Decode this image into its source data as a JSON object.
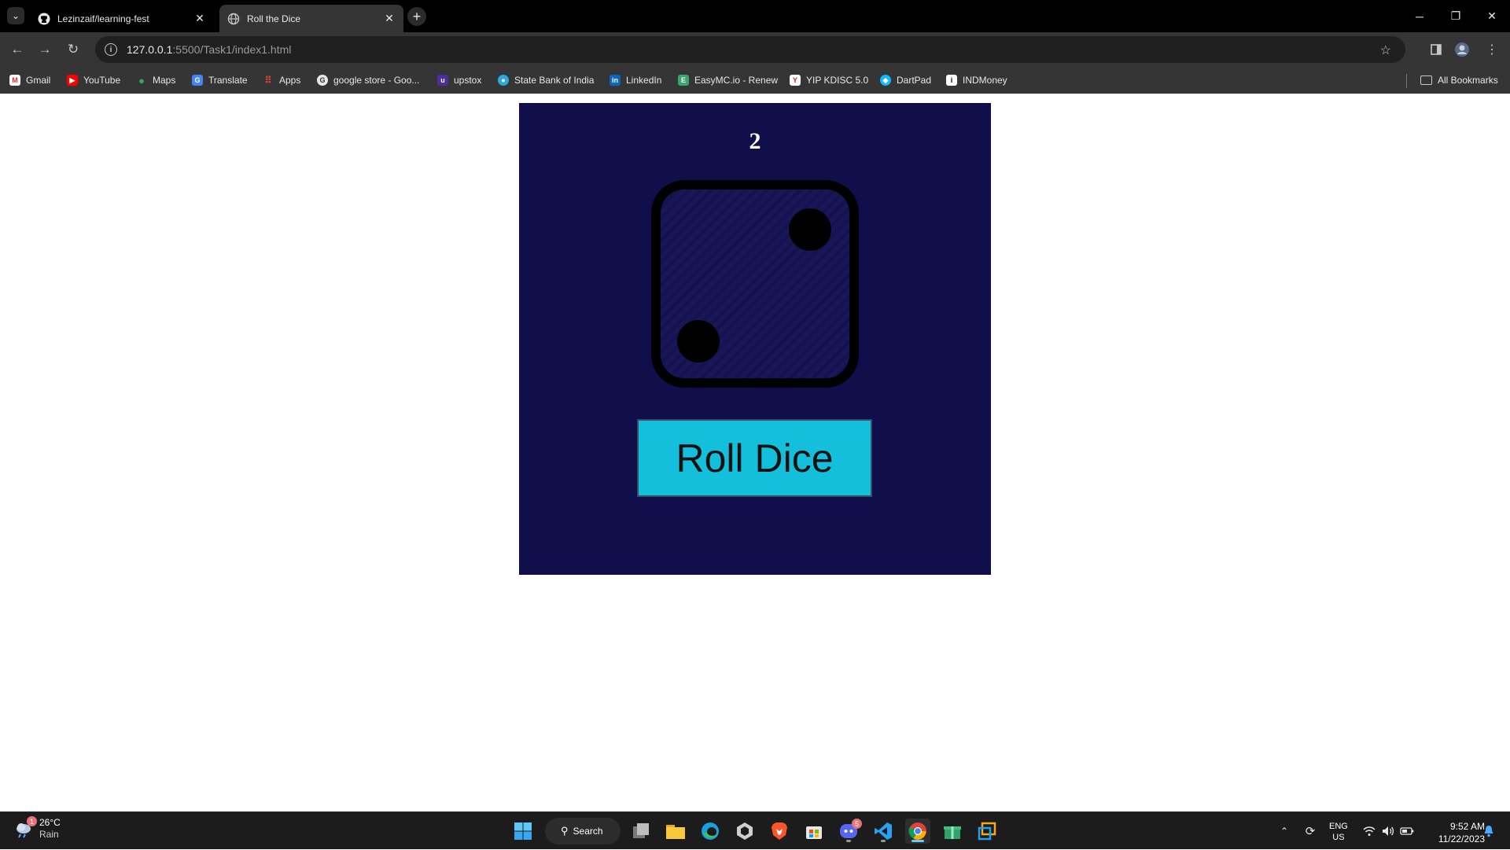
{
  "browser": {
    "tabs": [
      {
        "title": "Lezinzaif/learning-fest",
        "icon": "github-icon",
        "active": false
      },
      {
        "title": "Roll the Dice",
        "icon": "globe-icon",
        "active": true
      }
    ],
    "address": {
      "host": "127.0.0.1",
      "path": ":5500/Task1/index1.html"
    },
    "bookmarks": [
      {
        "label": "Gmail",
        "icon": "gmail-icon"
      },
      {
        "label": "YouTube",
        "icon": "youtube-icon"
      },
      {
        "label": "Maps",
        "icon": "maps-icon"
      },
      {
        "label": "Translate",
        "icon": "translate-icon"
      },
      {
        "label": "Apps",
        "icon": "apps-grid-icon"
      },
      {
        "label": "google store - Goo...",
        "icon": "google-store-icon"
      },
      {
        "label": "upstox",
        "icon": "upstox-icon"
      },
      {
        "label": "State Bank of India",
        "icon": "sbi-icon"
      },
      {
        "label": "LinkedIn",
        "icon": "linkedin-icon"
      },
      {
        "label": "EasyMC.io - Renew",
        "icon": "easymc-icon"
      },
      {
        "label": "YIP KDISC 5.0",
        "icon": "yip-icon"
      },
      {
        "label": "DartPad",
        "icon": "dartpad-icon"
      },
      {
        "label": "INDMoney",
        "icon": "indmoney-icon"
      }
    ],
    "all_bookmarks_label": "All Bookmarks"
  },
  "app": {
    "score": "2",
    "dice_face": 2,
    "roll_button_label": "Roll Dice",
    "colors": {
      "background": "#110f4b",
      "button": "#14bfdb",
      "dice_outline": "#000000"
    }
  },
  "taskbar": {
    "weather": {
      "temp": "26°C",
      "condition": "Rain",
      "badge": "1"
    },
    "search_label": "Search",
    "discord_badge": "5",
    "lang": {
      "line1": "ENG",
      "line2": "US"
    },
    "clock": {
      "time": "9:52 AM",
      "date": "11/22/2023"
    }
  }
}
